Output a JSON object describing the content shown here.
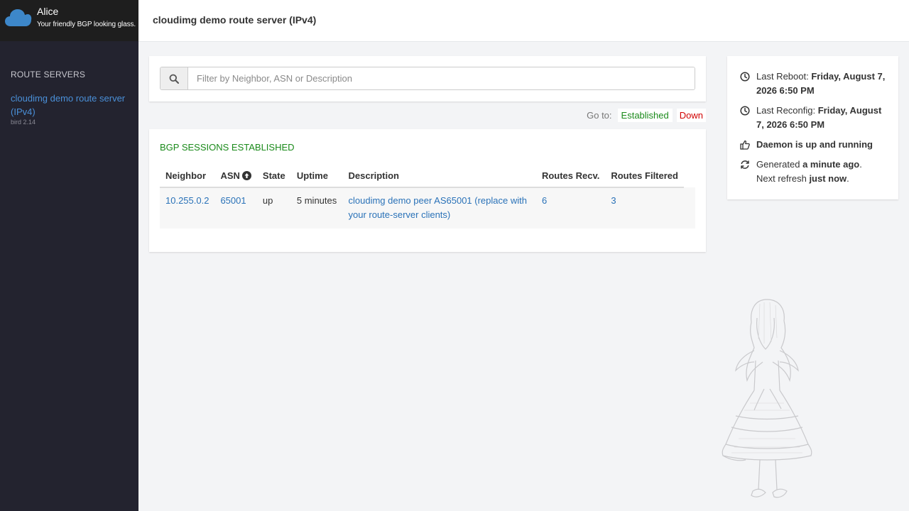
{
  "app": {
    "name": "Alice",
    "tagline": "Your friendly BGP looking glass."
  },
  "sidebar": {
    "heading": "ROUTE SERVERS",
    "route_servers": [
      {
        "name": "cloudimg demo route server (IPv4)",
        "software": "bird 2.14"
      }
    ]
  },
  "header": {
    "title": "cloudimg demo route server (IPv4)"
  },
  "search": {
    "placeholder": "Filter by Neighbor, ASN or Description",
    "value": ""
  },
  "goto": {
    "label": "Go to:",
    "established": "Established",
    "down": "Down"
  },
  "sessions": {
    "title": "BGP SESSIONS ESTABLISHED",
    "columns": [
      "Neighbor",
      "ASN",
      "State",
      "Uptime",
      "Description",
      "Routes Recv.",
      "Routes Filtered"
    ],
    "rows": [
      {
        "neighbor": "10.255.0.2",
        "asn": "65001",
        "state": "up",
        "uptime": "5 minutes",
        "description": "cloudimg demo peer AS65001 (replace with your route-server clients)",
        "routes_recv": "6",
        "routes_filtered": "3"
      }
    ]
  },
  "status": {
    "last_reboot_label": "Last Reboot:",
    "last_reboot_value": "Friday, August 7, 2026 6:50 PM",
    "last_reconfig_label": "Last Reconfig:",
    "last_reconfig_value": "Friday, August 7, 2026 6:50 PM",
    "daemon": "Daemon is up and running",
    "generated_label": "Generated",
    "generated_value": "a minute ago",
    "next_refresh_label": "Next refresh",
    "next_refresh_value": "just now"
  },
  "colors": {
    "sidebar_bg": "#23232f",
    "brand_bg": "#1e1e1e",
    "link": "#2a72b8",
    "established": "#1a8a1a",
    "down": "#d10000"
  },
  "icons": [
    "cloud-icon",
    "search-icon",
    "sort-up-icon",
    "clock-icon",
    "thumbs-up-icon",
    "refresh-icon"
  ]
}
